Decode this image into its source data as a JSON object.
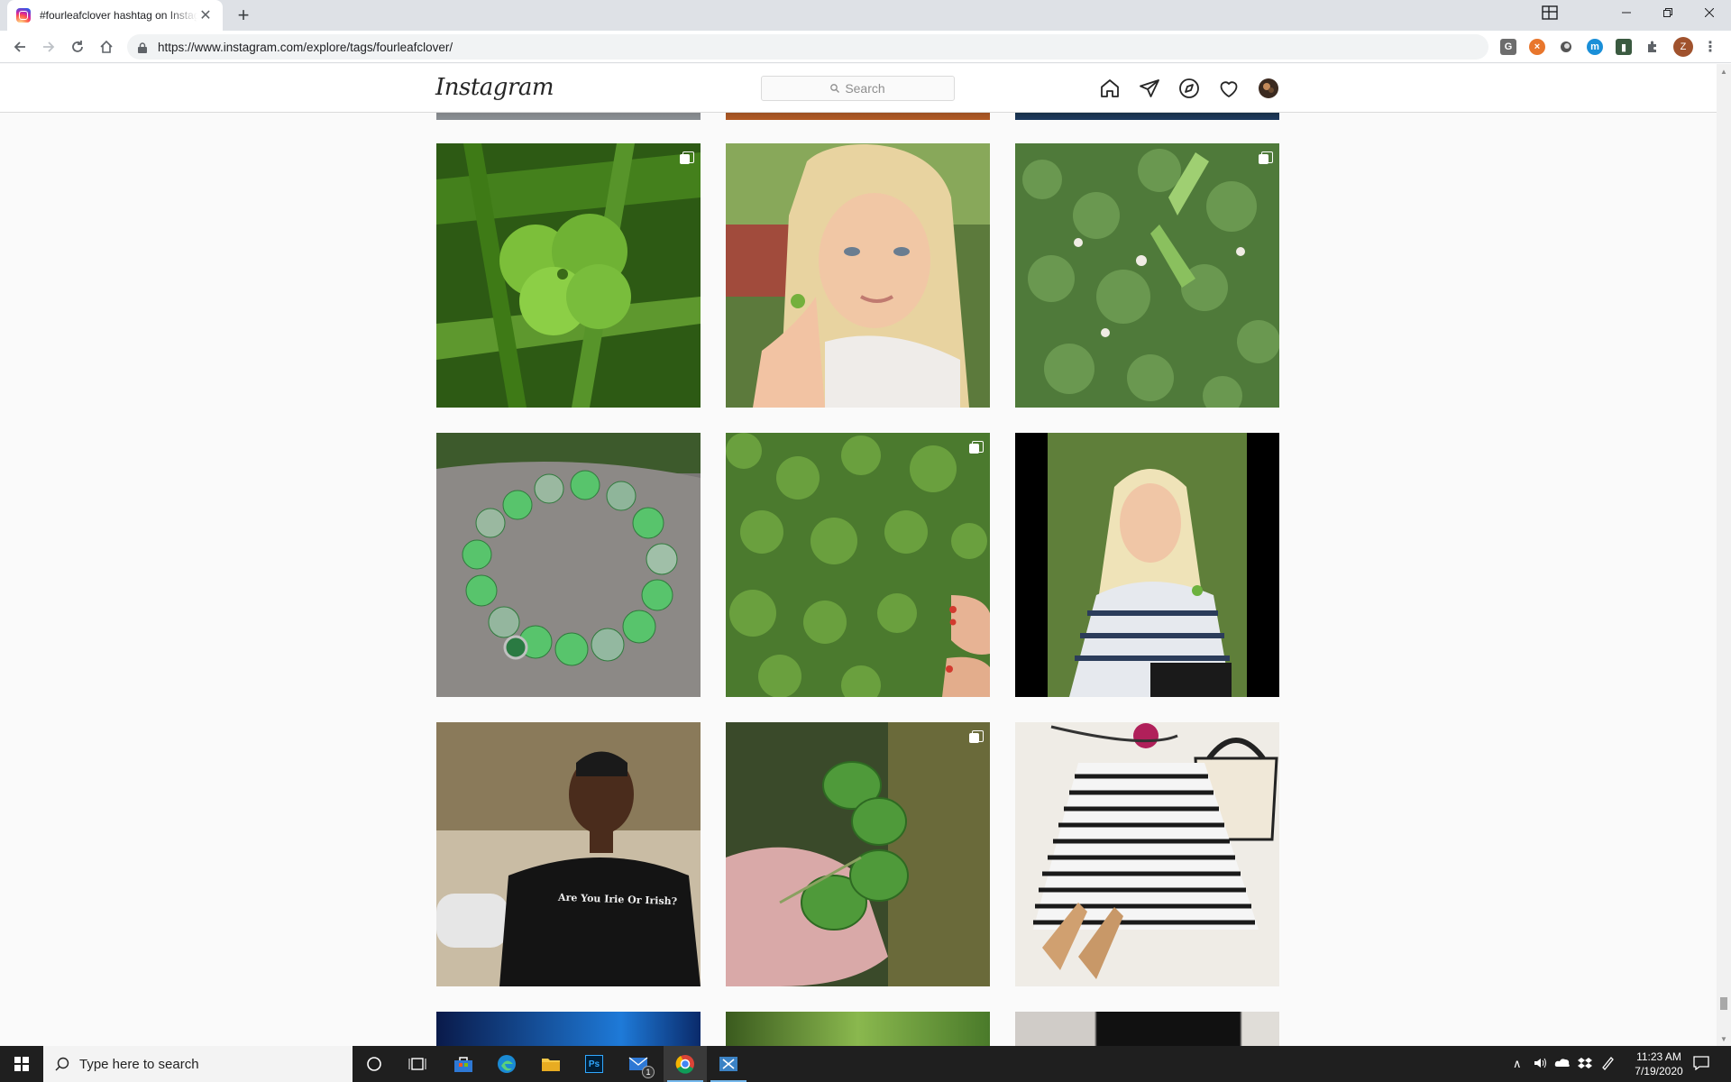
{
  "browser": {
    "tab_title": "#fourleafclover hashtag on Instagram",
    "tab_close": "✕",
    "new_tab": "+",
    "url": "https://www.instagram.com/explore/tags/fourleafclover/",
    "profile_initial": "Z"
  },
  "instagram": {
    "logo": "Instagram",
    "search_placeholder": "Search",
    "nav_icons": [
      "home-icon",
      "direct-icon",
      "explore-icon",
      "activity-heart-icon",
      "profile-avatar"
    ]
  },
  "posts": [
    {
      "id": "p1",
      "desc": "four leaf clover in grass with dew",
      "multi": true
    },
    {
      "id": "p2",
      "desc": "blonde child holding clover",
      "multi": false
    },
    {
      "id": "p3",
      "desc": "clover patch with white flowers",
      "multi": true
    },
    {
      "id": "p4",
      "desc": "green jade bead bracelet on rock",
      "multi": false
    },
    {
      "id": "p5",
      "desc": "clover lawn with bare feet",
      "multi": true
    },
    {
      "id": "p6",
      "desc": "blonde woman holding clover selfie",
      "multi": false
    },
    {
      "id": "p7",
      "desc": "man in t-shirt",
      "multi": false,
      "shirt_text": "Are You Irie Or Irish?"
    },
    {
      "id": "p8",
      "desc": "hand holding four leaf clover",
      "multi": true
    },
    {
      "id": "p9",
      "desc": "striped skirt outfit flat lay",
      "multi": false
    }
  ],
  "taskbar": {
    "search_placeholder": "Type here to search",
    "time": "11:23 AM",
    "date": "7/19/2020",
    "mail_badge": "1"
  }
}
